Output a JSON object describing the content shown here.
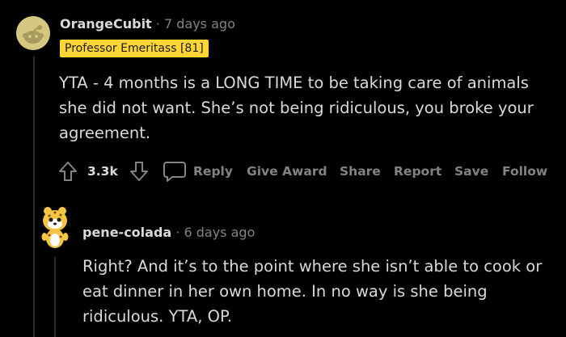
{
  "comment1": {
    "username": "OrangeCubit",
    "separator": "·",
    "time": "7 days ago",
    "flair": "Professor Emeritass [81]",
    "lines": [
      "YTA - 4 months is a LONG TIME to be taking care of animals",
      "she did not want. She’s not being ridiculous, you broke your",
      "agreement."
    ],
    "votes": "3.3k",
    "actions": {
      "reply": "Reply",
      "give_award": "Give Award",
      "share": "Share",
      "report": "Report",
      "save": "Save",
      "follow": "Follow"
    }
  },
  "comment2": {
    "username": "pene-colada",
    "separator": "·",
    "time": "6 days ago",
    "lines": [
      "Right? And it’s to the point where she isn’t able to cook or",
      "eat dinner in her own home. In no way is she being",
      "ridiculous. YTA, OP."
    ]
  },
  "colors": {
    "background": "#000000",
    "text": "#d7dadc",
    "muted": "#818384",
    "flair_bg": "#ffd635",
    "thread_line": "#2a2a2b"
  },
  "icons": [
    "snoo-avatar-icon",
    "upvote-arrow-icon",
    "downvote-arrow-icon",
    "comment-bubble-icon",
    "snoo-cheetah-avatar-icon"
  ]
}
